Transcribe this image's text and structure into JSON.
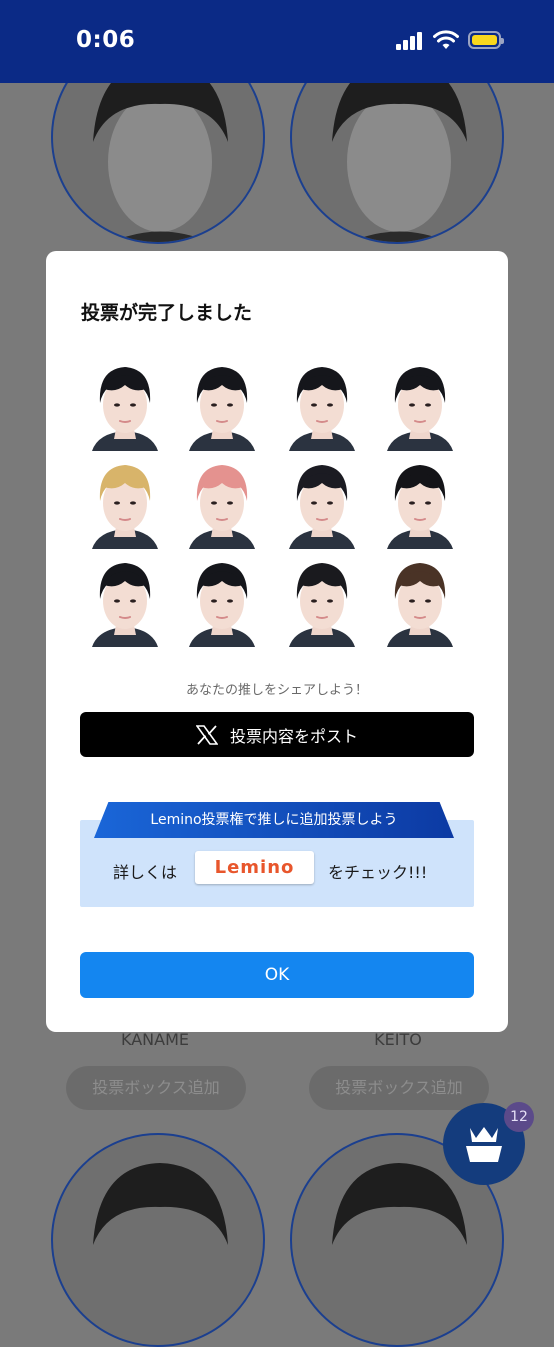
{
  "status_bar": {
    "time": "0:06"
  },
  "background": {
    "cards": [
      {
        "name": "KANAME",
        "button": "投票ボックス追加"
      },
      {
        "name": "KEITO",
        "button": "投票ボックス追加"
      }
    ],
    "fab_badge": "12"
  },
  "modal": {
    "title": "投票が完了しました",
    "share_prompt": "あなたの推しをシェアしよう！",
    "post_button": "投票内容をポスト",
    "promo": {
      "ribbon": "Lemino投票権で推しに追加投票しよう",
      "left_text": "詳しくは",
      "logo": "Lemino",
      "right_text": "をチェック!!!"
    },
    "ok_button": "OK"
  },
  "faces": [
    {
      "hair": "#15161b"
    },
    {
      "hair": "#15161b"
    },
    {
      "hair": "#15161b"
    },
    {
      "hair": "#15161b"
    },
    {
      "hair": "#d8b46a"
    },
    {
      "hair": "#e4928f"
    },
    {
      "hair": "#1b1b22"
    },
    {
      "hair": "#141418"
    },
    {
      "hair": "#15161b"
    },
    {
      "hair": "#15161b"
    },
    {
      "hair": "#1a1a1e"
    },
    {
      "hair": "#4a3326"
    }
  ]
}
